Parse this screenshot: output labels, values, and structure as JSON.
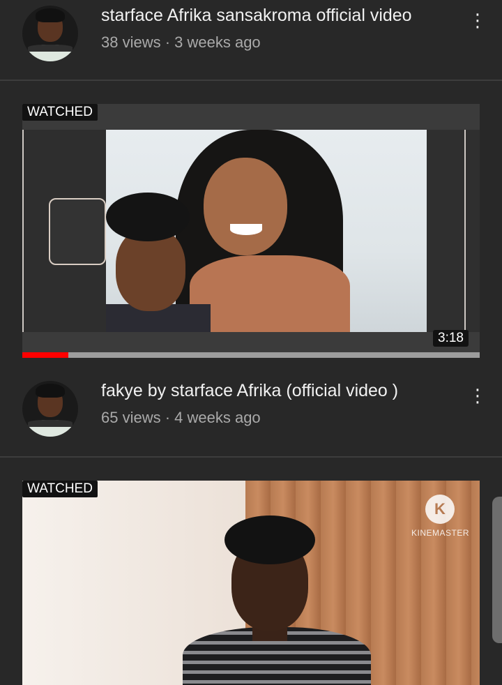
{
  "videos": [
    {
      "title": "starface Afrika sansakroma official video",
      "meta": "38 views · 3 weeks ago",
      "menu_icon": "⋮"
    },
    {
      "watched_label": "WATCHED",
      "duration": "3:18",
      "progress_fraction": 0.1,
      "title": "fakye by starface Afrika (official video )",
      "meta": "65 views · 4 weeks ago",
      "menu_icon": "⋮"
    },
    {
      "watched_label": "WATCHED",
      "watermark": "KINEMASTER",
      "watermark_icon": "K"
    }
  ],
  "colors": {
    "background": "#282828",
    "progress": "#ff0000",
    "meta_text": "#aaaaaa"
  }
}
